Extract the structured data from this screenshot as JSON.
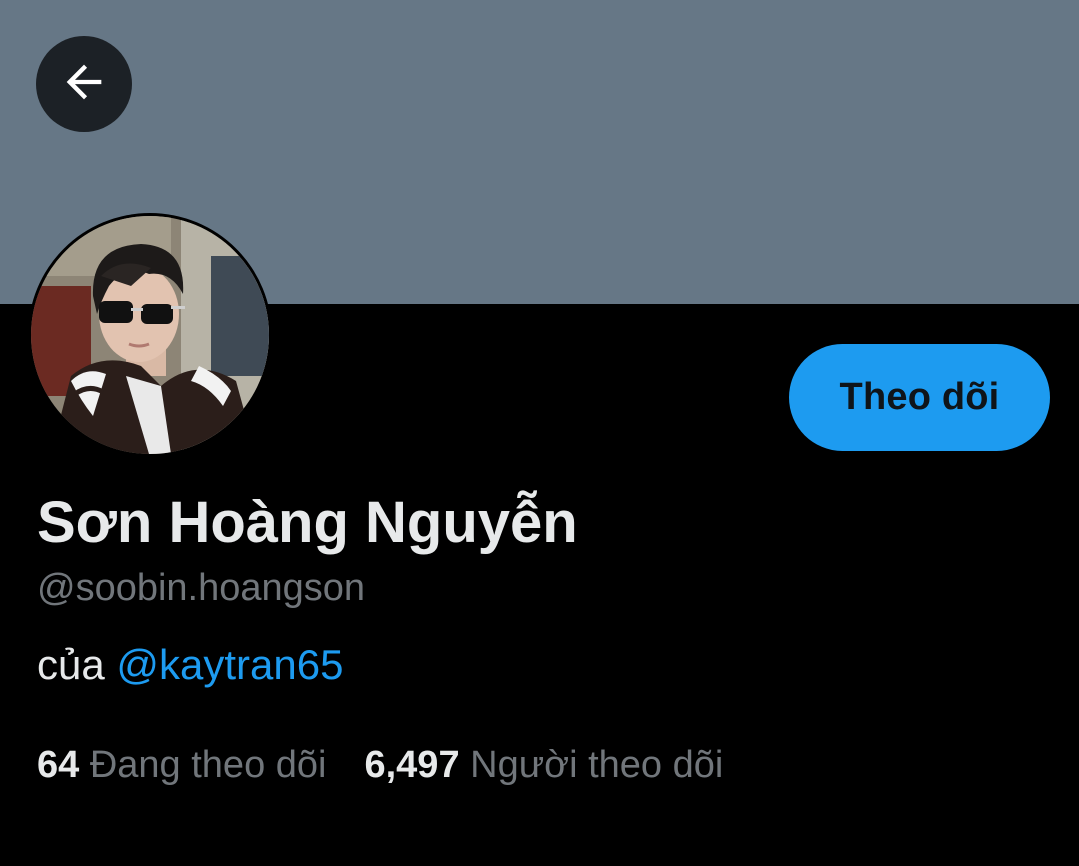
{
  "profile": {
    "display_name": "Sơn Hoàng Nguyễn",
    "handle": "@soobin.hoangson",
    "bio_prefix": "của ",
    "bio_mention": "@kaytran65"
  },
  "actions": {
    "follow_label": "Theo dõi"
  },
  "stats": {
    "following_count": "64",
    "following_label": "Đang theo dõi",
    "followers_count": "6,497",
    "followers_label": "Người theo dõi"
  },
  "icons": {
    "back": "arrow-left-icon"
  },
  "colors": {
    "banner": "#667786",
    "accent": "#1d9bf0",
    "background": "#000000",
    "primary_text": "#e7e9ea",
    "secondary_text": "#71767b"
  }
}
